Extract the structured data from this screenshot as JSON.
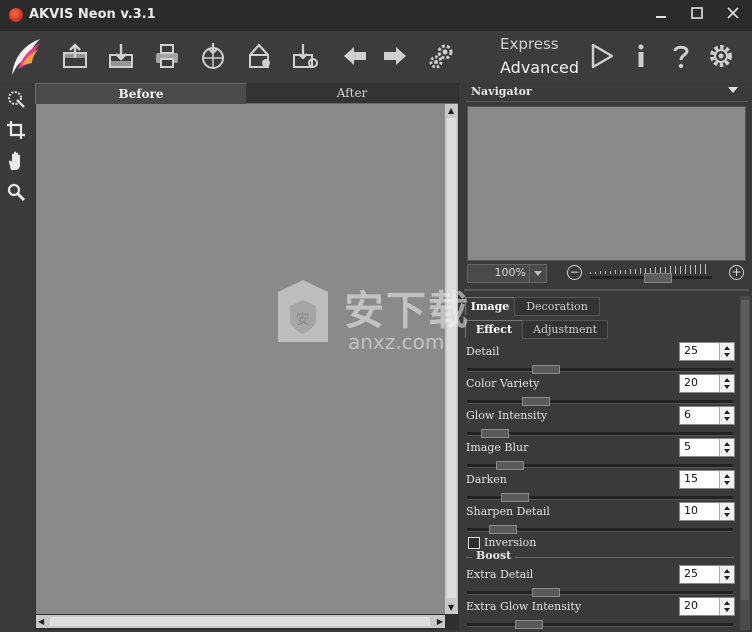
{
  "window": {
    "title": "AKVIS Neon v.3.1",
    "controls": [
      "minimize-icon",
      "maximize-icon",
      "close-icon"
    ]
  },
  "toolbar": {
    "buttons": [
      "app-logo",
      "open-icon",
      "save-icon",
      "print-icon",
      "import-icon",
      "share-icon",
      "export-settings-icon",
      "undo-arrow-icon",
      "redo-arrow-icon",
      "preferences-gears-icon"
    ],
    "mode_express": "Express",
    "mode_advanced": "Advanced",
    "right_buttons": [
      "run-play-icon",
      "info-icon",
      "help-icon",
      "settings-gear-icon"
    ]
  },
  "left_tools": [
    "stroke-tool-icon",
    "crop-icon",
    "hand-icon",
    "zoom-icon"
  ],
  "canvas": {
    "tabs": {
      "before": "Before",
      "after": "After"
    },
    "active_tab": "Before"
  },
  "navigator": {
    "title": "Navigator",
    "zoom_value": "100%"
  },
  "settings": {
    "tabs_top": {
      "image": "Image",
      "decoration": "Decoration"
    },
    "tabs_sub": {
      "effect": "Effect",
      "adjustment": "Adjustment"
    },
    "params": [
      {
        "label": "Detail",
        "value": "25",
        "pos": 0.27
      },
      {
        "label": "Color Variety",
        "value": "20",
        "pos": 0.23
      },
      {
        "label": "Glow Intensity",
        "value": "6",
        "pos": 0.06
      },
      {
        "label": "Image Blur",
        "value": "5",
        "pos": 0.12
      },
      {
        "label": "Darken",
        "value": "15",
        "pos": 0.14
      },
      {
        "label": "Sharpen Detail",
        "value": "10",
        "pos": 0.09
      }
    ],
    "inversion": {
      "label": "Inversion",
      "checked": false
    },
    "boost": {
      "title": "Boost",
      "params": [
        {
          "label": "Extra Detail",
          "value": "25",
          "pos": 0.27
        },
        {
          "label": "Extra Glow Intensity",
          "value": "20",
          "pos": 0.2
        }
      ]
    }
  },
  "watermark": {
    "text_cn": "安下载",
    "text_en": "anxz.com"
  }
}
